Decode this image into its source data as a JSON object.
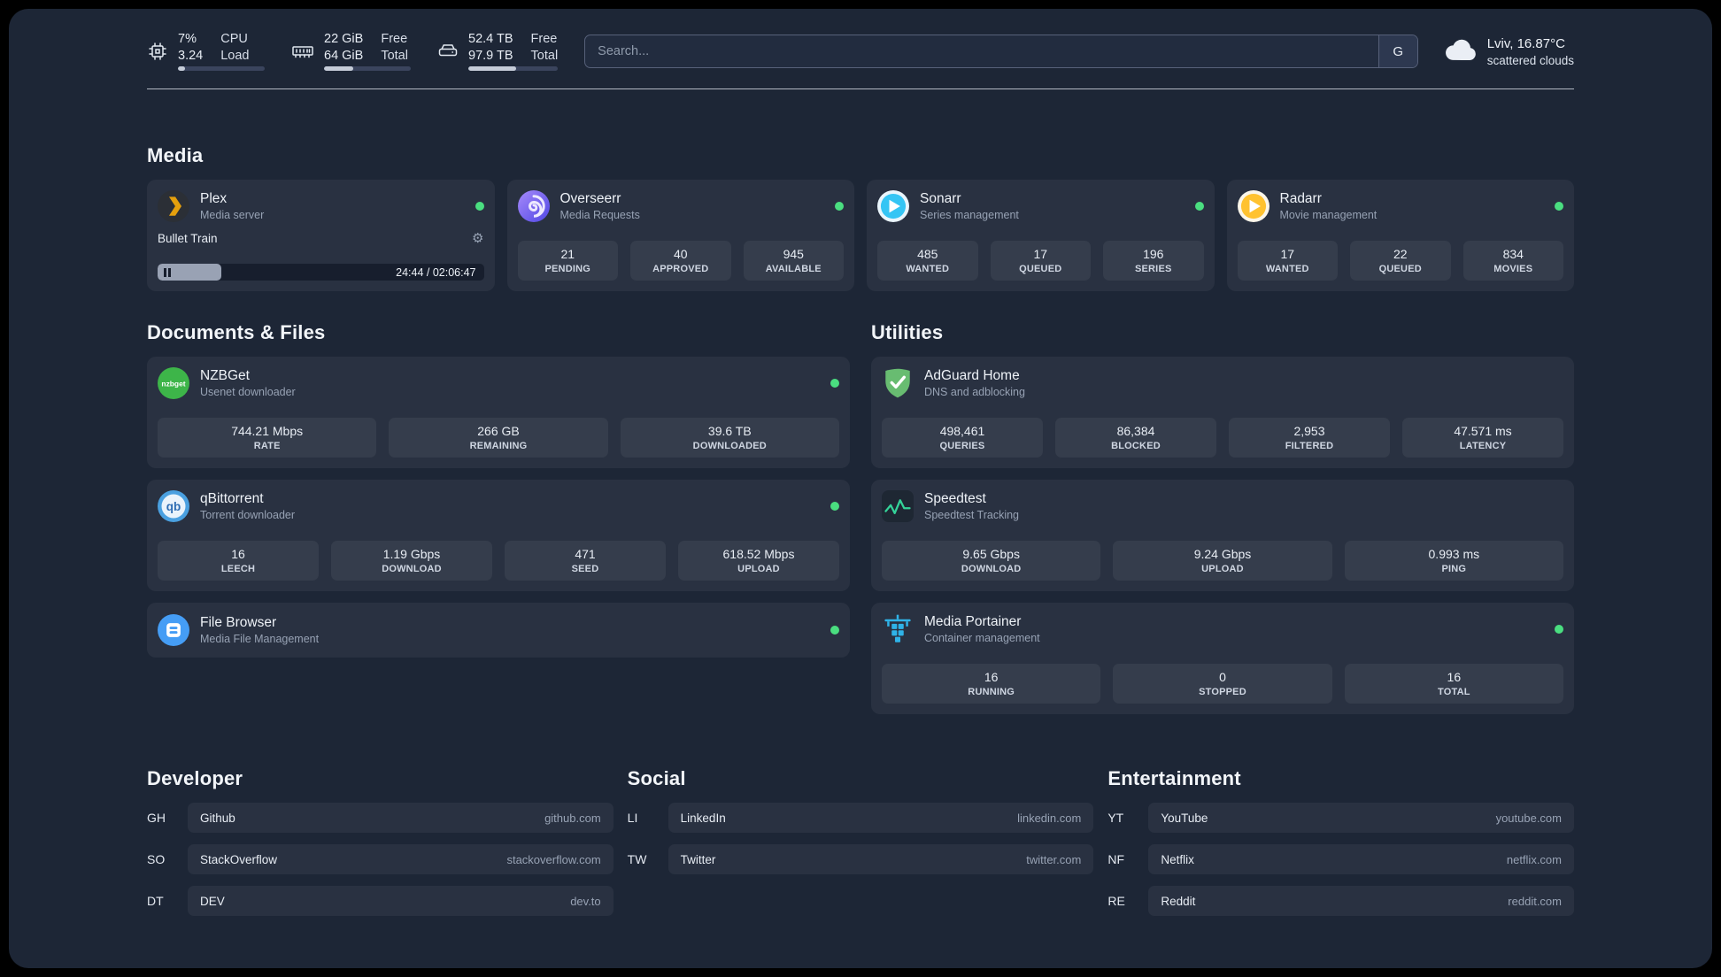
{
  "topbar": {
    "cpu": {
      "percent": "7%",
      "load": "3.24",
      "label_top": "CPU",
      "label_bottom": "Load",
      "bar": 8
    },
    "memory": {
      "free": "22 GiB",
      "total": "64 GiB",
      "label_top": "Free",
      "label_bottom": "Total",
      "bar": 34
    },
    "disk": {
      "free": "52.4 TB",
      "total": "97.9 TB",
      "label_top": "Free",
      "label_bottom": "Total",
      "bar": 53
    },
    "search": {
      "placeholder": "Search...",
      "provider": "G"
    },
    "weather": {
      "location": "Lviv, 16.87°C",
      "condition": "scattered clouds"
    }
  },
  "media": {
    "title": "Media",
    "plex": {
      "name": "Plex",
      "subtitle": "Media server",
      "now_playing": "Bullet Train",
      "time": "24:44 / 02:06:47",
      "progress": 19.5
    },
    "overseerr": {
      "name": "Overseerr",
      "subtitle": "Media Requests",
      "stats": [
        {
          "value": "21",
          "label": "PENDING"
        },
        {
          "value": "40",
          "label": "APPROVED"
        },
        {
          "value": "945",
          "label": "AVAILABLE"
        }
      ]
    },
    "sonarr": {
      "name": "Sonarr",
      "subtitle": "Series management",
      "stats": [
        {
          "value": "485",
          "label": "WANTED"
        },
        {
          "value": "17",
          "label": "QUEUED"
        },
        {
          "value": "196",
          "label": "SERIES"
        }
      ]
    },
    "radarr": {
      "name": "Radarr",
      "subtitle": "Movie management",
      "stats": [
        {
          "value": "17",
          "label": "WANTED"
        },
        {
          "value": "22",
          "label": "QUEUED"
        },
        {
          "value": "834",
          "label": "MOVIES"
        }
      ]
    }
  },
  "documents": {
    "title": "Documents & Files",
    "nzbget": {
      "name": "NZBGet",
      "subtitle": "Usenet downloader",
      "stats": [
        {
          "value": "744.21 Mbps",
          "label": "RATE"
        },
        {
          "value": "266 GB",
          "label": "REMAINING"
        },
        {
          "value": "39.6 TB",
          "label": "DOWNLOADED"
        }
      ]
    },
    "qbittorrent": {
      "name": "qBittorrent",
      "subtitle": "Torrent downloader",
      "stats": [
        {
          "value": "16",
          "label": "LEECH"
        },
        {
          "value": "1.19 Gbps",
          "label": "DOWNLOAD"
        },
        {
          "value": "471",
          "label": "SEED"
        },
        {
          "value": "618.52 Mbps",
          "label": "UPLOAD"
        }
      ]
    },
    "filebrowser": {
      "name": "File Browser",
      "subtitle": "Media File Management"
    }
  },
  "utilities": {
    "title": "Utilities",
    "adguard": {
      "name": "AdGuard Home",
      "subtitle": "DNS and adblocking",
      "stats": [
        {
          "value": "498,461",
          "label": "QUERIES"
        },
        {
          "value": "86,384",
          "label": "BLOCKED"
        },
        {
          "value": "2,953",
          "label": "FILTERED"
        },
        {
          "value": "47.571 ms",
          "label": "LATENCY"
        }
      ]
    },
    "speedtest": {
      "name": "Speedtest",
      "subtitle": "Speedtest Tracking",
      "stats": [
        {
          "value": "9.65 Gbps",
          "label": "DOWNLOAD"
        },
        {
          "value": "9.24 Gbps",
          "label": "UPLOAD"
        },
        {
          "value": "0.993 ms",
          "label": "PING"
        }
      ]
    },
    "portainer": {
      "name": "Media Portainer",
      "subtitle": "Container management",
      "stats": [
        {
          "value": "16",
          "label": "RUNNING"
        },
        {
          "value": "0",
          "label": "STOPPED"
        },
        {
          "value": "16",
          "label": "TOTAL"
        }
      ]
    }
  },
  "bookmarks": [
    {
      "title": "Developer",
      "items": [
        {
          "abbr": "GH",
          "name": "Github",
          "url": "github.com"
        },
        {
          "abbr": "SO",
          "name": "StackOverflow",
          "url": "stackoverflow.com"
        },
        {
          "abbr": "DT",
          "name": "DEV",
          "url": "dev.to"
        }
      ]
    },
    {
      "title": "Social",
      "items": [
        {
          "abbr": "LI",
          "name": "LinkedIn",
          "url": "linkedin.com"
        },
        {
          "abbr": "TW",
          "name": "Twitter",
          "url": "twitter.com"
        }
      ]
    },
    {
      "title": "Entertainment",
      "items": [
        {
          "abbr": "YT",
          "name": "YouTube",
          "url": "youtube.com"
        },
        {
          "abbr": "NF",
          "name": "Netflix",
          "url": "netflix.com"
        },
        {
          "abbr": "RE",
          "name": "Reddit",
          "url": "reddit.com"
        }
      ]
    }
  ]
}
